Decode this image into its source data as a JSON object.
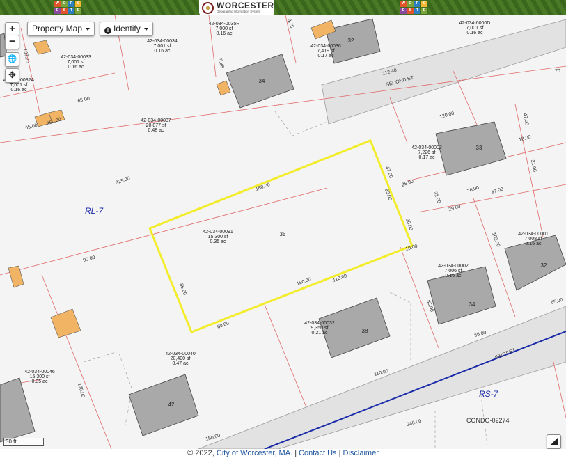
{
  "header": {
    "title": "WORCESTER",
    "subtitle": "Geographic Information System",
    "logo_left_letters": [
      "W",
      "O",
      "R",
      "C",
      "E",
      "S",
      "T",
      "E"
    ],
    "logo_right_letters": [
      "W",
      "O",
      "R",
      "C",
      "E",
      "S",
      "T",
      "E"
    ]
  },
  "controls": {
    "zoom_in": "+",
    "zoom_out": "−",
    "property_map_label": "Property Map",
    "identify_label": "Identify"
  },
  "scale_label": "30 ft",
  "streets": [
    {
      "name": "SECOND ST"
    },
    {
      "name": "FIRST ST"
    }
  ],
  "zones": [
    {
      "label": "RL-7"
    },
    {
      "label": "RS-7"
    }
  ],
  "condo_label": "CONDO-02274",
  "parcels": [
    {
      "id": "42-034-0035R",
      "sf": "7,000 sf",
      "ac": "0.16 ac"
    },
    {
      "id": "42-034-0000D",
      "sf": "7,001 sf",
      "ac": "0.16 ac"
    },
    {
      "id": "42-034-00034",
      "sf": "7,001 sf",
      "ac": "0.16 ac"
    },
    {
      "id": "42-034-00033",
      "sf": "7,001 sf",
      "ac": "0.16 ac"
    },
    {
      "id": "42-034-00036",
      "sf": "7,419 sf",
      "ac": "0.17 ac"
    },
    {
      "id": "42-034-0032A",
      "sf": "7,001 sf",
      "ac": "0.16 ac"
    },
    {
      "id": "42-034-00037",
      "sf": "20,877 sf",
      "ac": "0.48 ac"
    },
    {
      "id": "42-034-00003",
      "sf": "7,226 sf",
      "ac": "0.17 ac"
    },
    {
      "id": "42-034-00091",
      "sf": "15,300 sf",
      "ac": "0.35 ac"
    },
    {
      "id": "42-034-00001",
      "sf": "7,008 sf",
      "ac": "0.16 ac"
    },
    {
      "id": "42-034-00002",
      "sf": "7,006 sf",
      "ac": "0.16 ac"
    },
    {
      "id": "42-034-00032",
      "sf": "9,350 sf",
      "ac": "0.21 ac"
    },
    {
      "id": "42-034-00040",
      "sf": "20,400 sf",
      "ac": "0.47 ac"
    },
    {
      "id": "42-034-00046",
      "sf": "15,300 sf",
      "ac": "0.35 ac"
    }
  ],
  "house_numbers": [
    "32",
    "34",
    "33",
    "35",
    "32",
    "34",
    "38",
    "42"
  ],
  "dimensions": [
    "107.70",
    "65.00",
    "65.00",
    "260.00",
    "3.75",
    "5.88",
    "112.40",
    "120.00",
    "47.00",
    "18.00",
    "21.00",
    "70",
    "325.00",
    "180.00",
    "47.00",
    "83.00",
    "26.00",
    "21.00",
    "76.00",
    "47.00",
    "29.00",
    "38.00",
    "10.00",
    "102.00",
    "90.00",
    "85.00",
    "180.00",
    "110.00",
    "60.00",
    "85.00",
    "65.00",
    "65.00",
    "170.00",
    "110.00",
    "240.00",
    "150.00"
  ],
  "footer": {
    "copyright": "© 2022,",
    "city_link": "City of Worcester, MA.",
    "sep1": "|",
    "contact_link": "Contact Us",
    "sep2": "|",
    "disclaimer_link": "Disclaimer"
  },
  "colors": {
    "header_green": "#3f6e1e",
    "selected_parcel": "#f2ec2a",
    "building_gray": "#a9a9a9",
    "garage_orange": "#f1b464",
    "zone_boundary": "#1a2aa8",
    "parcel_line": "#e06a6a",
    "zone_label": "#1a2aa8"
  }
}
